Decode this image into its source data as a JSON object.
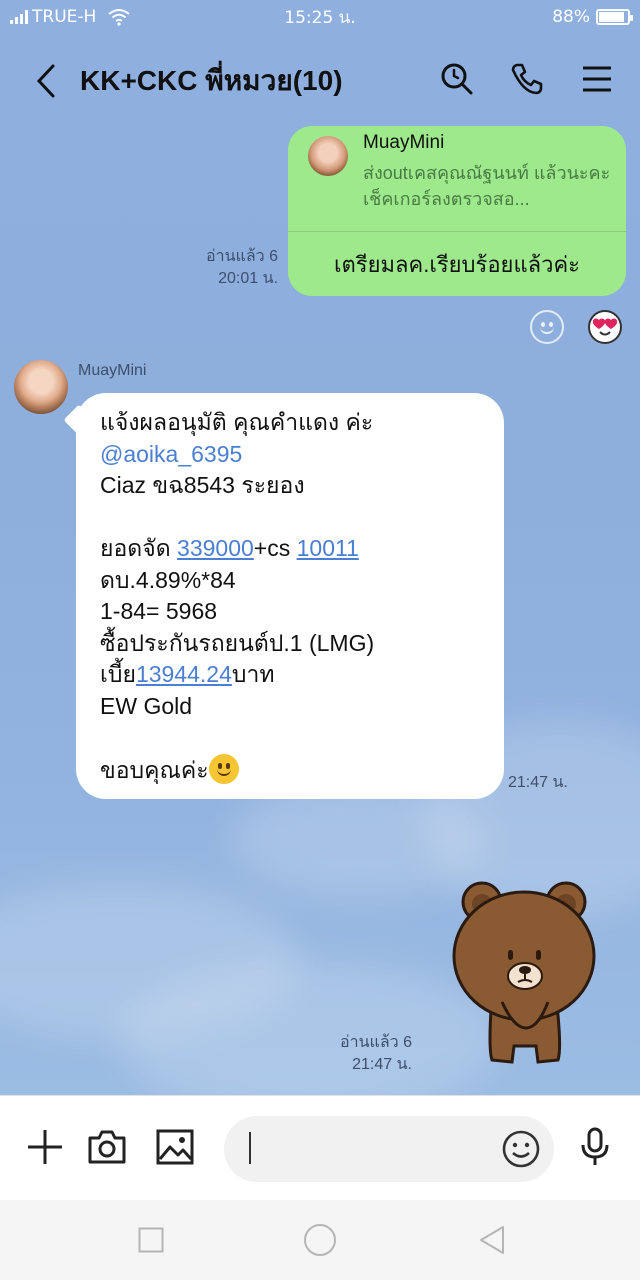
{
  "status_bar": {
    "carrier": "TRUE-H",
    "time": "15:25 น.",
    "battery": "88%",
    "battery_level": 0.88
  },
  "header": {
    "title": "KK+CKC พี่หมวย(10)",
    "icons": [
      "back-icon",
      "search-icon",
      "phone-icon",
      "menu-icon"
    ]
  },
  "messages": {
    "outgoing_reply": {
      "reply_name": "MuayMini",
      "reply_text": "ส่งoutเคสคุณณัฐนนท์ แล้วนะคะ เช็คเกอร์ลงตรวจสอ...",
      "text": "เตรียมลค.เรียบร้อยแล้วค่ะ",
      "read": "อ่านแล้ว 6",
      "time": "20:01 น.",
      "reaction": "heart-eyes-emoji"
    },
    "incoming": {
      "sender": "MuayMini",
      "time": "21:47 น.",
      "line1": "แจ้งผลอนุมัติ คุณคำแดง ค่ะ",
      "mention": "@aoika_6395",
      "line3": "Ciaz ขฉ8543 ระยอง",
      "line5_prefix": "ยอดจัด ",
      "line5_link1": "339000",
      "line5_mid": "+cs ",
      "line5_link2": "10011",
      "line6": "ดบ.4.89%*84",
      "line7": "1-84= 5968",
      "line8": "ซื้อประกันรถยนต์ป.1 (LMG)",
      "line9_prefix": "เบี้ย",
      "line9_link": "13944.24",
      "line9_suffix": "บาท",
      "line10": "EW Gold",
      "line12": "ขอบคุณค่ะ"
    },
    "sticker": {
      "name": "brown-bear-sticker",
      "read": "อ่านแล้ว 6",
      "time": "21:47 น."
    }
  },
  "input_bar": {
    "placeholder": "",
    "value": ""
  },
  "colors": {
    "chat_bg": "#8fb0de",
    "outgoing_bubble": "#9de98c",
    "incoming_bubble": "#ffffff",
    "link": "#4a7fd3"
  }
}
